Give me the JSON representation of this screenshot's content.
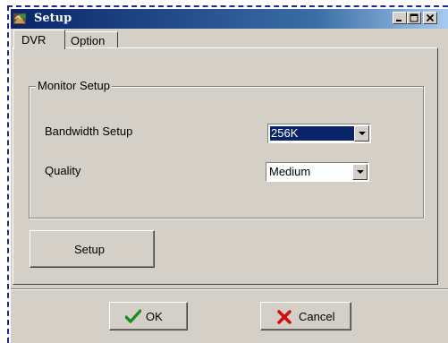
{
  "window": {
    "title": "Setup"
  },
  "tabs": [
    {
      "label": "DVR",
      "active": true
    },
    {
      "label": "Option",
      "active": false
    }
  ],
  "monitor_setup": {
    "group_label": "Monitor Setup",
    "bandwidth": {
      "label": "Bandwidth Setup",
      "value": "256K"
    },
    "quality": {
      "label": "Quality",
      "value": "Medium"
    }
  },
  "setup_button": {
    "label": "Setup"
  },
  "dialog_buttons": {
    "ok": {
      "label": "OK",
      "icon": "checkmark-icon"
    },
    "cancel": {
      "label": "Cancel",
      "icon": "cross-icon"
    }
  },
  "colors": {
    "title_bar": "#0a246a",
    "face": "#d4d0c8",
    "selection": "#0a246a",
    "check": "#1e8c1e",
    "cross": "#d01010"
  }
}
